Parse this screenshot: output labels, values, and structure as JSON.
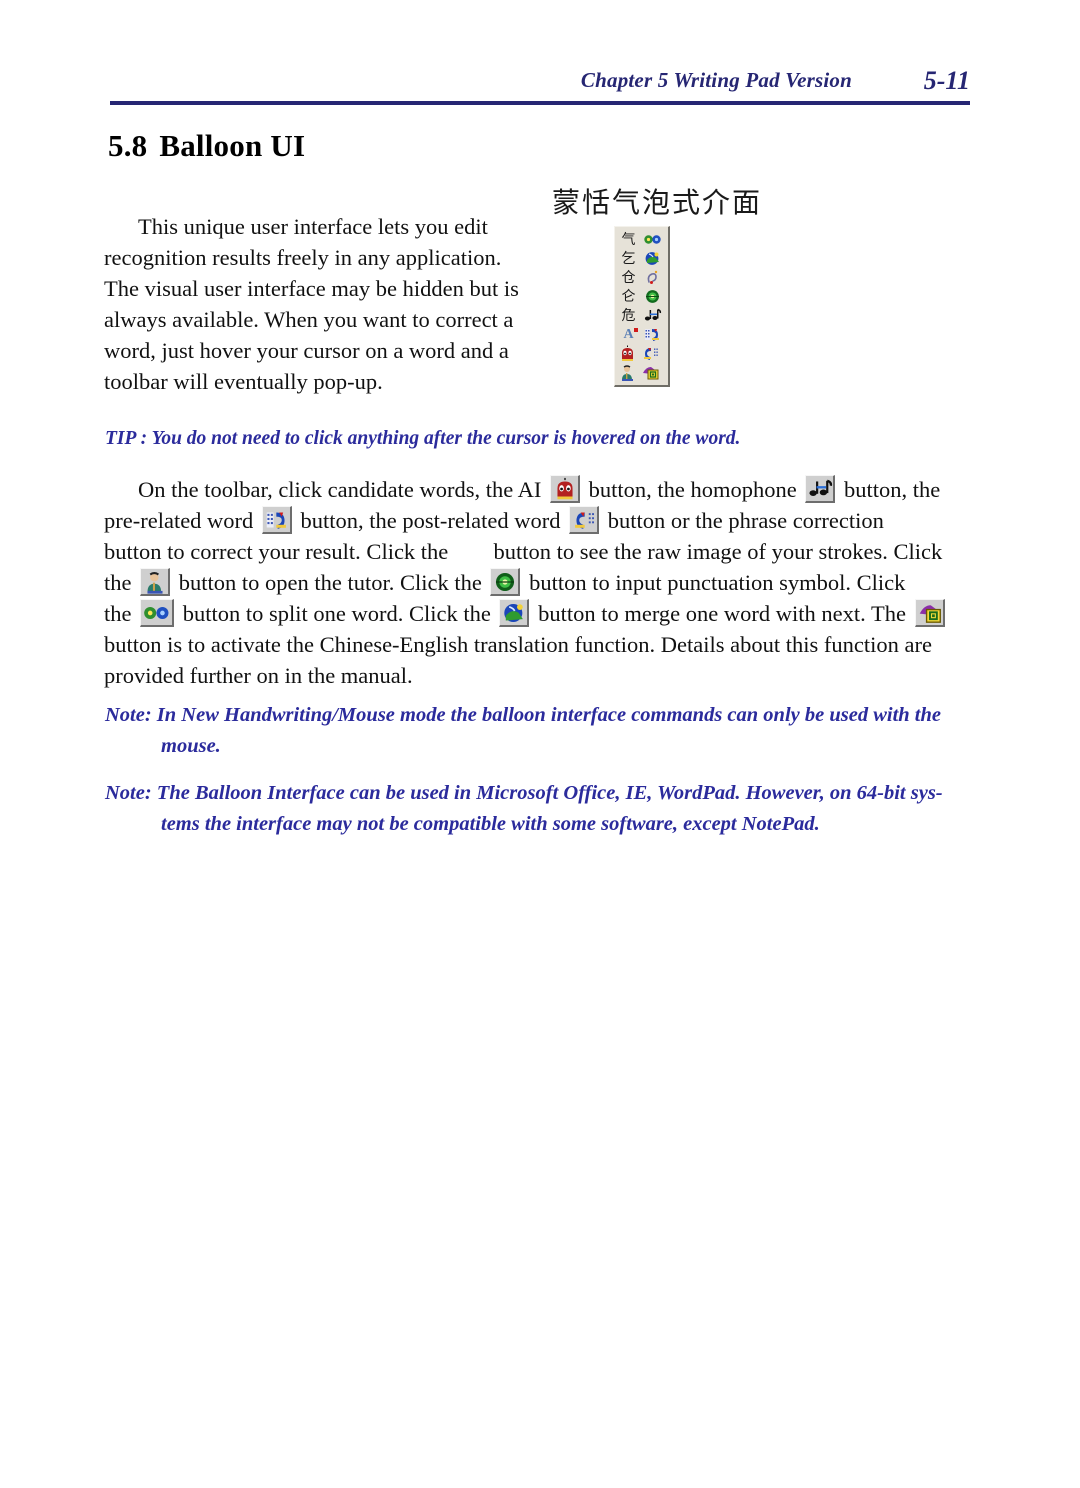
{
  "header": {
    "chapter": "Chapter 5 Writing Pad Version",
    "page_number": "5-11",
    "rule_color": "#262673"
  },
  "section": {
    "number": "5.8",
    "title": "Balloon UI"
  },
  "intro": {
    "text": "This unique user interface lets you edit recognition results freely in any application. The visual user interface may be hidden but is always available. When you want to correct a word, just hover your cursor on a word and a toolbar will eventually pop-up."
  },
  "figure": {
    "caption": "蒙恬气泡式介面",
    "toolbar_rows": [
      {
        "candidate": "气",
        "icon": "split-word-icon"
      },
      {
        "candidate": "乞",
        "icon": "merge-word-icon"
      },
      {
        "candidate": "仓",
        "icon": "raw-strokes-icon"
      },
      {
        "candidate": "仑",
        "icon": "punctuation-icon"
      },
      {
        "candidate": "危",
        "icon": "homophone-icon"
      },
      {
        "candidate": "A",
        "icon": "pre-related-word-icon"
      },
      {
        "candidate": "",
        "icon": "ai-icon",
        "second_icon": "post-related-word-icon"
      },
      {
        "candidate": "",
        "icon": "tutor-icon",
        "second_icon": "translation-icon"
      }
    ]
  },
  "tip": {
    "text": "TIP : You do not need to click anything after the cursor is hovered on the word."
  },
  "instructions": {
    "line1_a": "On the toolbar, click candidate words,  the AI",
    "line1_b": "button, the homophone",
    "line1_c": "button, the",
    "line2_a": "pre-related word",
    "line2_b": "button, the post-related word",
    "line2_c": "button or the phrase correction",
    "line3_a": "button to correct your result. Click the",
    "line3_b": "button to see the raw image of your strokes. Click",
    "line4_a": "the",
    "line4_b": "button to open the tutor. Click the",
    "line4_c": "button to input punctuation symbol. Click",
    "line5_a": "the",
    "line5_b": "button to split one word. Click the",
    "line5_c": "button to merge one word with next. The",
    "line6": "button is to activate the Chinese-English translation function. Details about this function are",
    "line7": "provided further on in the manual."
  },
  "notes": [
    {
      "first": "Note: In New Handwriting/Mouse mode the balloon interface commands can only be used with the",
      "hang": "mouse."
    },
    {
      "first": "Note: The Balloon Interface can be used in Microsoft Office, IE, WordPad. However, on 64-bit sys-",
      "hang": "tems the interface may not be compatible with some software, except NotePad."
    }
  ],
  "colors": {
    "accent_blue": "#2b2b9c",
    "header_navy": "#262673",
    "text_black": "#111111",
    "toolbar_face": "#e6e2d8",
    "button_face": "#cfcfcf"
  }
}
